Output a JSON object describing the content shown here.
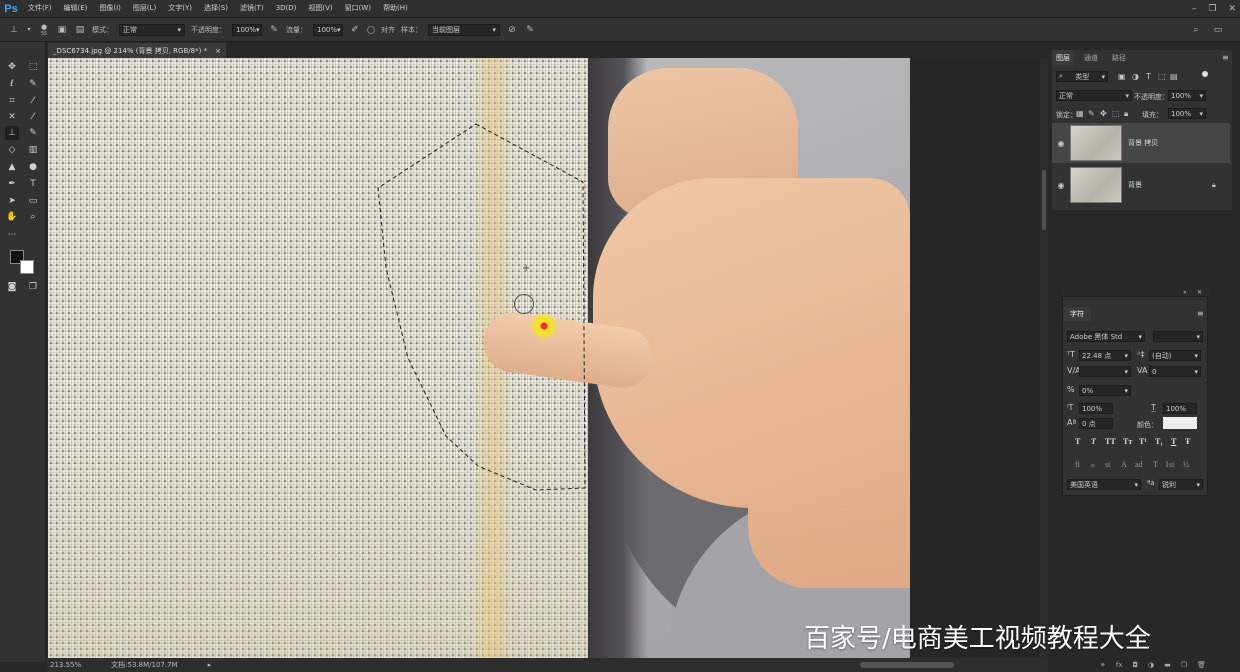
{
  "app": {
    "logo": "Ps"
  },
  "menu": [
    "文件(F)",
    "编辑(E)",
    "图像(I)",
    "图层(L)",
    "文字(Y)",
    "选择(S)",
    "滤镜(T)",
    "3D(D)",
    "视图(V)",
    "窗口(W)",
    "帮助(H)"
  ],
  "options": {
    "brush_size": "55",
    "mode_label": "模式：",
    "mode_value": "正常",
    "opacity_label": "不透明度：",
    "opacity_value": "100%",
    "flow_label": "流量：",
    "flow_value": "100%",
    "align_label": "对齐",
    "sample_label": "样本：",
    "sample_value": "当前图层"
  },
  "document": {
    "tab_title": "_DSC6734.jpg @ 214% (背景 拷贝, RGB/8*) *",
    "tab_close": "×"
  },
  "status": {
    "zoom": "213.55%",
    "doc_info": "文档:53.8M/107.7M"
  },
  "layers_panel": {
    "tabs": [
      "图层",
      "通道",
      "路径"
    ],
    "kind_filter": "类型",
    "blend_mode": "正常",
    "opacity_label": "不透明度：",
    "opacity_value": "100%",
    "lock_label": "锁定：",
    "fill_label": "填充：",
    "fill_value": "100%",
    "layers": [
      {
        "name": "背景 拷贝",
        "visible": true,
        "selected": true
      },
      {
        "name": "背景",
        "visible": true,
        "locked": true
      }
    ]
  },
  "character_panel": {
    "title": "字符",
    "font_family": "Adobe 黑体 Std",
    "font_size": "22.48 点",
    "leading": "(自动)",
    "tracking": "0",
    "scale_pct": "0%",
    "vertical_scale": "100%",
    "horizontal_scale": "100%",
    "baseline": "0 点",
    "color_label": "颜色：",
    "style_buttons": [
      "T",
      "T",
      "TT",
      "Tт",
      "T¹",
      "T₁",
      "T",
      "Ŧ"
    ],
    "opentype_buttons": [
      "fi",
      "ℴ",
      "st",
      "A",
      "ad",
      "T",
      "1st",
      "½"
    ],
    "language": "美国英语",
    "antialias": "锐利"
  },
  "watermark": "百家号/电商美工视频教程大全",
  "icons": {
    "title_search": "search-icon",
    "toolbar": [
      "move-icon",
      "marquee-icon",
      "lasso-icon",
      "quick-select-icon",
      "crop-icon",
      "eyedropper-icon",
      "healing-icon",
      "brush-icon",
      "clone-stamp-icon",
      "history-brush-icon",
      "eraser-icon",
      "gradient-icon",
      "blur-icon",
      "dodge-icon",
      "pen-icon",
      "type-icon",
      "path-select-icon",
      "rectangle-icon",
      "hand-icon",
      "zoom-icon"
    ]
  }
}
